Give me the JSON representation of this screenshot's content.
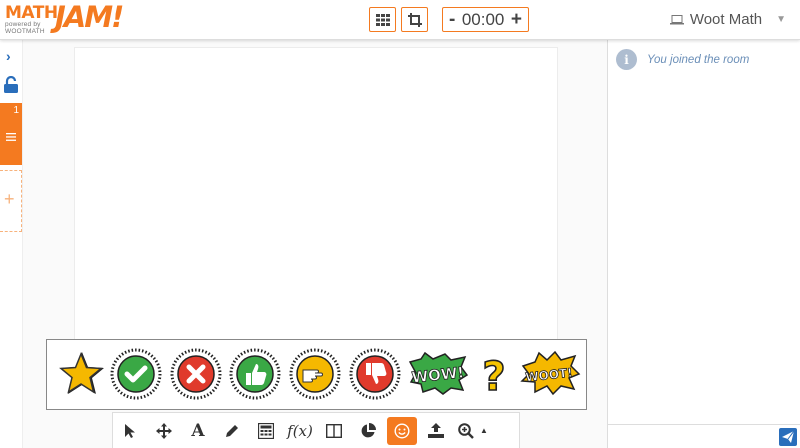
{
  "header": {
    "logo": {
      "math": "MATH",
      "jam": "JAM!",
      "powered": "powered by",
      "brand": "WOOTMATH"
    },
    "timer": {
      "minus": "-",
      "value": "00:00",
      "plus": "+"
    },
    "user": {
      "name": "Woot Math"
    }
  },
  "left_rail": {
    "page_number": "1"
  },
  "stickers": [
    "star",
    "checkmark",
    "x-mark",
    "thumbs-up",
    "pointing-hand",
    "thumbs-down",
    "wow",
    "question-mark",
    "woot"
  ],
  "sticker_text": {
    "wow": "WOW!",
    "woot": "WOOT!",
    "question": "?"
  },
  "toolbar": {
    "items": [
      "select-arrow",
      "move",
      "text",
      "pencil",
      "calculator",
      "function",
      "split-view",
      "pie-chart",
      "stickers",
      "upload",
      "zoom"
    ],
    "fx_label": "f(x)",
    "text_label": "A",
    "active_item": "stickers"
  },
  "chat": {
    "messages": [
      {
        "icon": "info-icon",
        "text": "You joined the room"
      }
    ]
  },
  "colors": {
    "accent": "#f47a20",
    "link": "#2a6ebb",
    "message": "#6b8fb8"
  }
}
